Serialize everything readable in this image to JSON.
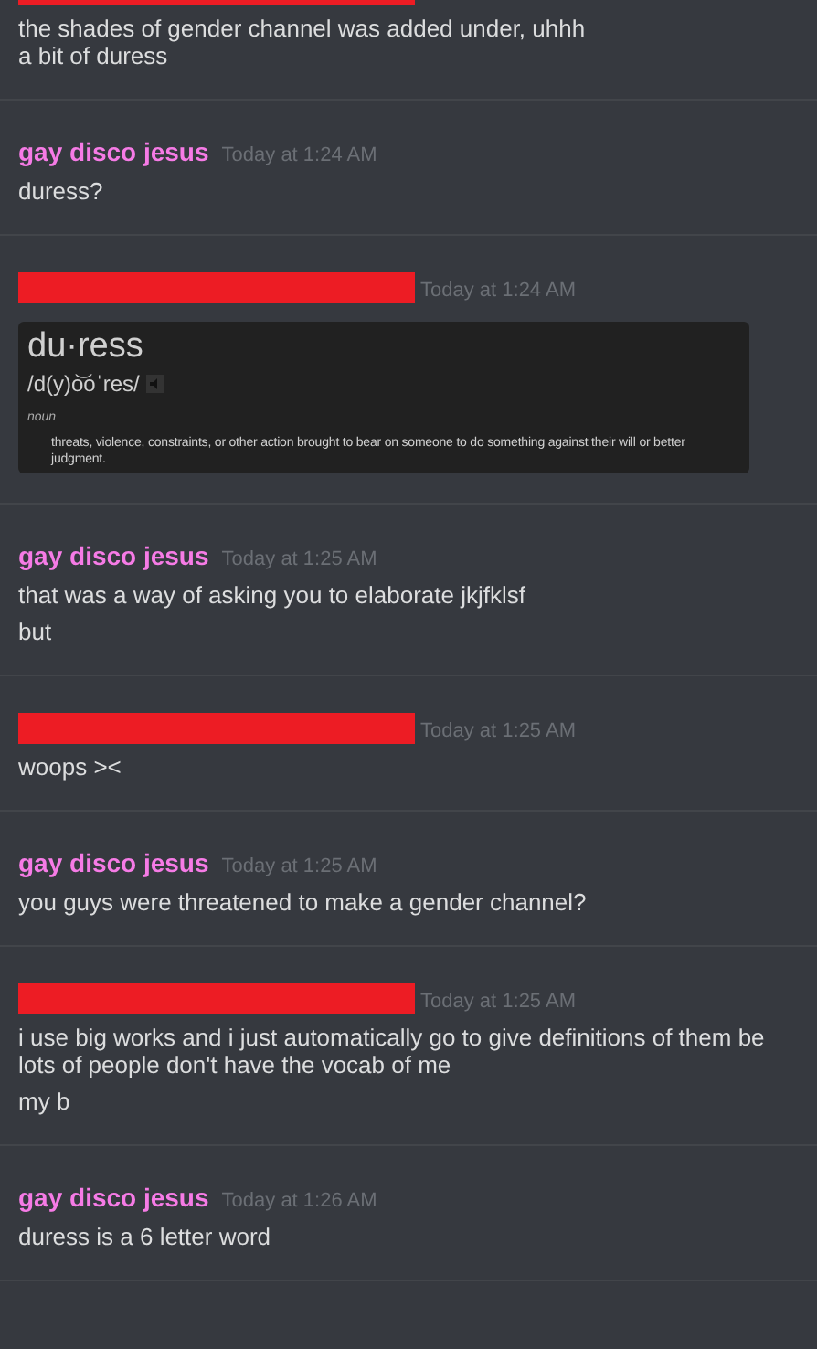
{
  "messages": [
    {
      "kind": "redacted",
      "paragraphs": [
        [
          "the shades of gender channel was added under, uhhh",
          "a bit of duress"
        ]
      ]
    },
    {
      "kind": "user",
      "author": "gay disco jesus",
      "time": "Today at 1:24 AM",
      "paragraphs": [
        [
          "duress?"
        ]
      ]
    },
    {
      "kind": "redacted",
      "time": "Today at 1:24 AM",
      "embed": {
        "word": "du·ress",
        "phonetic": "/d(y)o͝oˈres/",
        "part_of_speech": "noun",
        "definition": "threats, violence, constraints, or other action brought to bear on someone to do something against their will or better judgment."
      }
    },
    {
      "kind": "user",
      "author": "gay disco jesus",
      "time": "Today at 1:25 AM",
      "paragraphs": [
        [
          "that was a way of asking you to elaborate jkjfklsf"
        ],
        [
          "but"
        ]
      ]
    },
    {
      "kind": "redacted",
      "time": "Today at 1:25 AM",
      "paragraphs": [
        [
          "woops ><"
        ]
      ]
    },
    {
      "kind": "user",
      "author": "gay disco jesus",
      "time": "Today at 1:25 AM",
      "paragraphs": [
        [
          "you guys were threatened to make a gender channel?"
        ]
      ]
    },
    {
      "kind": "redacted",
      "time": "Today at 1:25 AM",
      "paragraphs": [
        [
          "i use big works and i just automatically go to give definitions of them be",
          "lots of people don't have the vocab of me"
        ],
        [
          "my b"
        ]
      ]
    },
    {
      "kind": "user",
      "author": "gay disco jesus",
      "time": "Today at 1:26 AM",
      "paragraphs": [
        [
          "duress is a 6 letter word"
        ]
      ]
    }
  ]
}
